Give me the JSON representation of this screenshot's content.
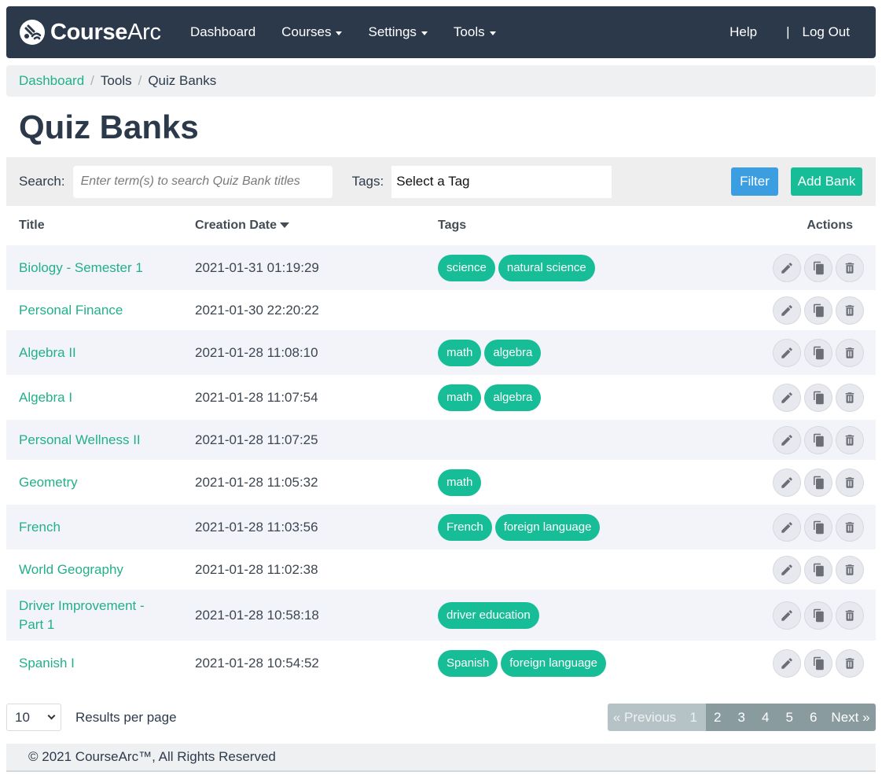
{
  "brand": {
    "name_bold": "Course",
    "name_light": "Arc"
  },
  "nav": {
    "items": [
      {
        "label": "Dashboard",
        "dropdown": false
      },
      {
        "label": "Courses",
        "dropdown": true
      },
      {
        "label": "Settings",
        "dropdown": true
      },
      {
        "label": "Tools",
        "dropdown": true
      }
    ],
    "help": "Help",
    "separator": "|",
    "logout": "Log Out"
  },
  "breadcrumb": {
    "items": [
      "Dashboard",
      "Tools",
      "Quiz Banks"
    ],
    "separator": "/"
  },
  "page_title": "Quiz Banks",
  "toolbar": {
    "search_label": "Search:",
    "search_placeholder": "Enter term(s) to search Quiz Bank titles",
    "tags_label": "Tags:",
    "tags_value": "Select a Tag",
    "filter_label": "Filter",
    "add_label": "Add Bank"
  },
  "table": {
    "headers": {
      "title": "Title",
      "date": "Creation Date",
      "tags": "Tags",
      "actions": "Actions"
    },
    "rows": [
      {
        "title": "Biology - Semester 1",
        "date": "2021-01-31 01:19:29",
        "tags": [
          "science",
          "natural science"
        ]
      },
      {
        "title": "Personal Finance",
        "date": "2021-01-30 22:20:22",
        "tags": []
      },
      {
        "title": "Algebra II",
        "date": "2021-01-28 11:08:10",
        "tags": [
          "math",
          "algebra"
        ]
      },
      {
        "title": "Algebra I",
        "date": "2021-01-28 11:07:54",
        "tags": [
          "math",
          "algebra"
        ]
      },
      {
        "title": "Personal Wellness II",
        "date": "2021-01-28 11:07:25",
        "tags": []
      },
      {
        "title": "Geometry",
        "date": "2021-01-28 11:05:32",
        "tags": [
          "math"
        ]
      },
      {
        "title": "French",
        "date": "2021-01-28 11:03:56",
        "tags": [
          "French",
          "foreign language"
        ]
      },
      {
        "title": "World Geography",
        "date": "2021-01-28 11:02:38",
        "tags": []
      },
      {
        "title": "Driver Improvement - Part 1",
        "date": "2021-01-28 10:58:18",
        "tags": [
          "driver education"
        ]
      },
      {
        "title": "Spanish I",
        "date": "2021-01-28 10:54:52",
        "tags": [
          "Spanish",
          "foreign language"
        ]
      }
    ]
  },
  "pagination": {
    "per_page_value": "10",
    "per_page_label": "Results per page",
    "previous": "« Previous",
    "pages": [
      "1",
      "2",
      "3",
      "4",
      "5",
      "6"
    ],
    "current_page": "1",
    "next": "Next »"
  },
  "footer": {
    "copyright": "© 2021 CourseArc™, All Rights Reserved"
  },
  "colors": {
    "nav_bg": "#2b394b",
    "accent_green": "#16bd96",
    "link_green": "#22b089",
    "filter_blue": "#3a9ee0"
  }
}
